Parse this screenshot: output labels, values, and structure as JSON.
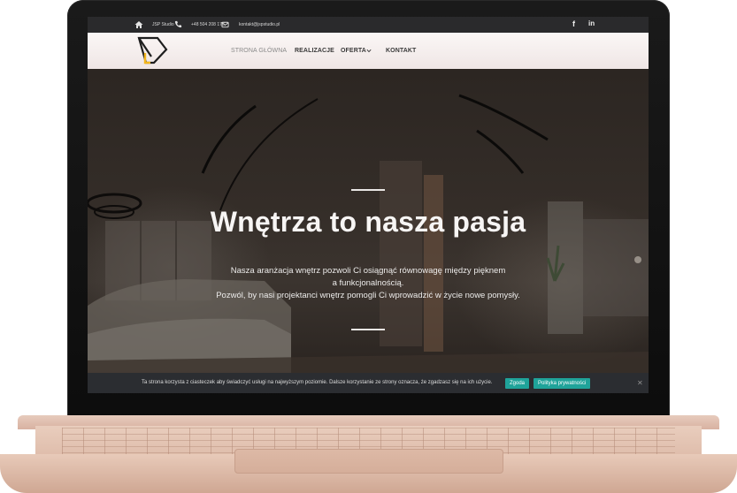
{
  "topbar": {
    "studio_name": "JSP Studio",
    "phone": "+48 504 208 178",
    "email": "kontakt@jspstudio.pl",
    "social_facebook": "f",
    "social_linkedin": "in"
  },
  "nav": {
    "items": [
      {
        "label": "STRONA GŁÓWNA",
        "active": false
      },
      {
        "label": "REALIZACJE",
        "active": true
      },
      {
        "label": "OFERTA",
        "has_dropdown": true
      },
      {
        "label": "KONTAKT"
      }
    ]
  },
  "hero": {
    "title": "Wnętrza to nasza pasja",
    "description_line1": "Nasza aranżacja wnętrz pozwoli Ci osiągnąć równowagę między pięknem",
    "description_line2": "a funkcjonalnością.",
    "description_line3": "Pozwól, by nasi projektanci wnętrz pomogli Ci wprowadzić w życie nowe pomysły."
  },
  "cookie": {
    "text": "Ta strona korzysta z ciasteczek aby świadczyć usługi na najwyższym poziomie. Dalsze korzystanie ze strony oznacza, że zgadzasz się na ich użycie.",
    "accept_label": "Zgoda",
    "policy_label": "Polityka prywatności",
    "close_label": "✕"
  },
  "colors": {
    "accent": "#1fa39a",
    "topbar_bg": "#2a2a2c",
    "logo_yellow": "#f2b61c"
  },
  "icons": [
    "home-icon",
    "phone-icon",
    "mail-icon",
    "facebook-icon",
    "linkedin-icon",
    "chevron-down-icon",
    "close-icon"
  ]
}
